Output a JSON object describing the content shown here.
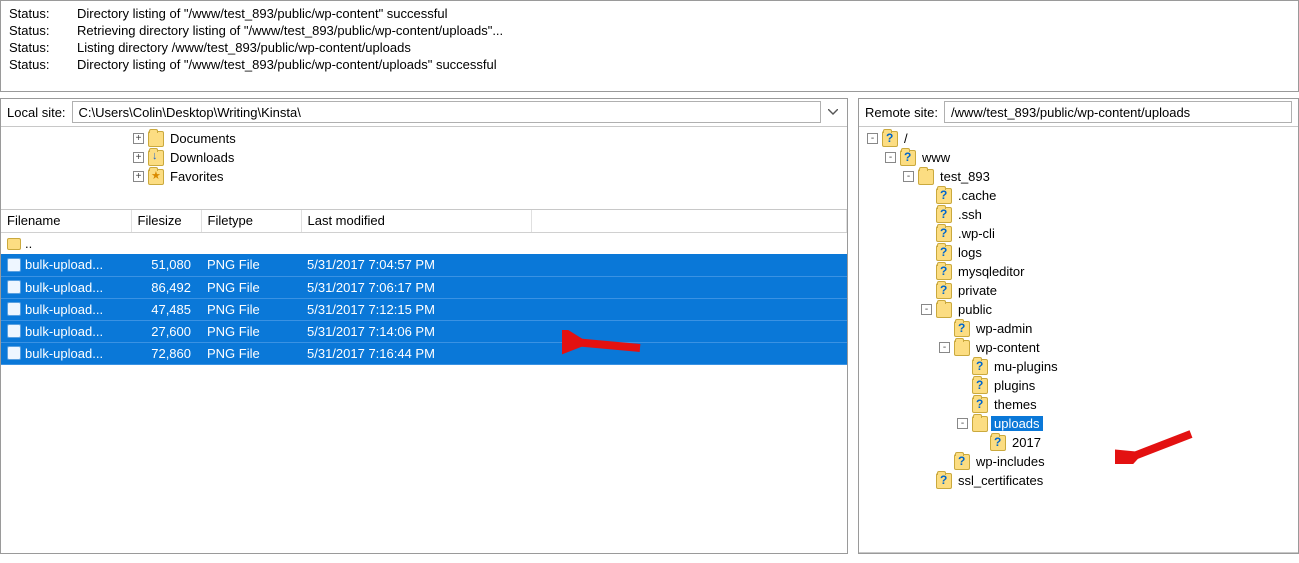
{
  "status_label": "Status:",
  "status_lines": [
    "Directory listing of \"/www/test_893/public/wp-content\" successful",
    "Retrieving directory listing of \"/www/test_893/public/wp-content/uploads\"...",
    "Listing directory /www/test_893/public/wp-content/uploads",
    "Directory listing of \"/www/test_893/public/wp-content/uploads\" successful"
  ],
  "local": {
    "label": "Local site:",
    "path": "C:\\Users\\Colin\\Desktop\\Writing\\Kinsta\\",
    "tree": [
      {
        "depth": 7,
        "twisty": "+",
        "icon": "folder",
        "label": "Documents"
      },
      {
        "depth": 7,
        "twisty": "+",
        "icon": "folder-arrow",
        "label": "Downloads"
      },
      {
        "depth": 7,
        "twisty": "+",
        "icon": "folder-star",
        "label": "Favorites"
      }
    ],
    "columns": {
      "filename": "Filename",
      "filesize": "Filesize",
      "filetype": "Filetype",
      "modified": "Last modified"
    },
    "parent_row": "..",
    "files": [
      {
        "name": "bulk-upload...",
        "size": "51,080",
        "type": "PNG File",
        "modified": "5/31/2017 7:04:57 PM"
      },
      {
        "name": "bulk-upload...",
        "size": "86,492",
        "type": "PNG File",
        "modified": "5/31/2017 7:06:17 PM"
      },
      {
        "name": "bulk-upload...",
        "size": "47,485",
        "type": "PNG File",
        "modified": "5/31/2017 7:12:15 PM"
      },
      {
        "name": "bulk-upload...",
        "size": "27,600",
        "type": "PNG File",
        "modified": "5/31/2017 7:14:06 PM"
      },
      {
        "name": "bulk-upload...",
        "size": "72,860",
        "type": "PNG File",
        "modified": "5/31/2017 7:16:44 PM"
      }
    ]
  },
  "remote": {
    "label": "Remote site:",
    "path": "/www/test_893/public/wp-content/uploads",
    "tree": [
      {
        "depth": 0,
        "twisty": "-",
        "icon": "q",
        "label": "/"
      },
      {
        "depth": 1,
        "twisty": "-",
        "icon": "q",
        "label": "www"
      },
      {
        "depth": 2,
        "twisty": "-",
        "icon": "folder",
        "label": "test_893"
      },
      {
        "depth": 3,
        "twisty": "",
        "icon": "q",
        "label": ".cache"
      },
      {
        "depth": 3,
        "twisty": "",
        "icon": "q",
        "label": ".ssh"
      },
      {
        "depth": 3,
        "twisty": "",
        "icon": "q",
        "label": ".wp-cli"
      },
      {
        "depth": 3,
        "twisty": "",
        "icon": "q",
        "label": "logs"
      },
      {
        "depth": 3,
        "twisty": "",
        "icon": "q",
        "label": "mysqleditor"
      },
      {
        "depth": 3,
        "twisty": "",
        "icon": "q",
        "label": "private"
      },
      {
        "depth": 3,
        "twisty": "-",
        "icon": "folder",
        "label": "public"
      },
      {
        "depth": 4,
        "twisty": "",
        "icon": "q",
        "label": "wp-admin"
      },
      {
        "depth": 4,
        "twisty": "-",
        "icon": "folder",
        "label": "wp-content"
      },
      {
        "depth": 5,
        "twisty": "",
        "icon": "q",
        "label": "mu-plugins"
      },
      {
        "depth": 5,
        "twisty": "",
        "icon": "q",
        "label": "plugins"
      },
      {
        "depth": 5,
        "twisty": "",
        "icon": "q",
        "label": "themes"
      },
      {
        "depth": 5,
        "twisty": "-",
        "icon": "folder",
        "label": "uploads",
        "selected": true
      },
      {
        "depth": 6,
        "twisty": "",
        "icon": "q",
        "label": "2017"
      },
      {
        "depth": 4,
        "twisty": "",
        "icon": "q",
        "label": "wp-includes"
      },
      {
        "depth": 3,
        "twisty": "",
        "icon": "q",
        "label": "ssl_certificates"
      }
    ]
  }
}
